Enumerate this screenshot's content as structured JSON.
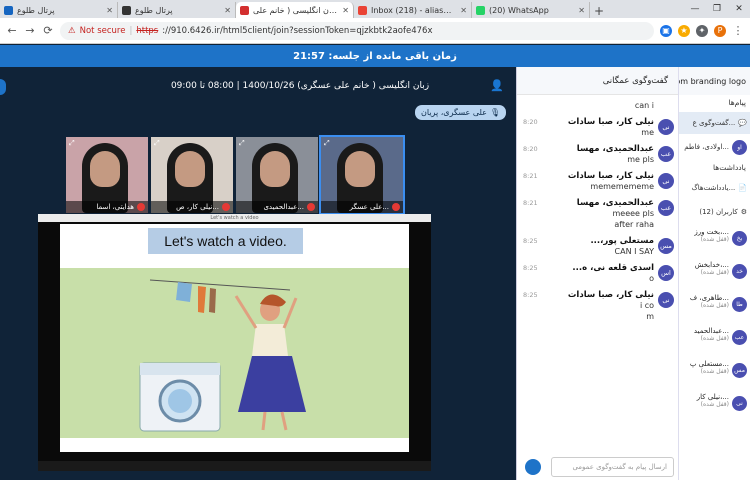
{
  "browser": {
    "tabs": [
      {
        "title": "پرتال طلوع",
        "fav_color": "#1565c0",
        "active": false
      },
      {
        "title": "پرتال طلوع",
        "fav_color": "#333333",
        "active": false
      },
      {
        "title": "طلوع - زبان انگلیسی ( خانم علی",
        "fav_color": "#d32f2f",
        "active": true
      },
      {
        "title": "Inbox (218) - aliasgaripariani@",
        "fav_color": "#ea4335",
        "active": false
      },
      {
        "title": "(20) WhatsApp",
        "fav_color": "#25d366",
        "active": false
      }
    ],
    "new_tab": "+",
    "window_controls": [
      "—",
      "❐",
      "✕"
    ],
    "nav": {
      "back": "←",
      "forward": "→",
      "reload": "⟳"
    },
    "address": {
      "warning_icon": "⚠",
      "not_secure": "Not secure",
      "scheme": "https",
      "rest": "://910.6426.ir/html5client/join?sessionToken=qjzkbtk2aofe476x"
    },
    "profile_initial": "P"
  },
  "header": {
    "timer_label": "زمان باقی مانده از جلسه: 21:57"
  },
  "session": {
    "info": "زبان انگلیسی ( خانم علی عسگری) 1400/10/26 | 08:00 تا 09:00",
    "presenter_badge": "علی عسگری، پریان"
  },
  "video_tiles": [
    {
      "label": "علی عسگر...",
      "active": true,
      "bg": "#5a6a8a"
    },
    {
      "label": "عبدالحمیدی...",
      "active": false,
      "bg": "#8a8f98"
    },
    {
      "label": "نیلی کار، ص...",
      "active": false,
      "bg": "#d8d0c8"
    },
    {
      "label": "هدایتی، اسما",
      "active": false,
      "bg": "#c9a3a8"
    }
  ],
  "slide": {
    "player_title": "Let's watch a video",
    "title": "Let's watch a video."
  },
  "chat": {
    "header": "گفت‌وگوی عمگانی",
    "input_placeholder": "ارسال پیام به گفت‌وگوی عمومی",
    "messages": [
      {
        "initials": "",
        "name": "",
        "time": "",
        "text": "can i"
      },
      {
        "initials": "نی",
        "name": "نیلی کار، صبا سادات",
        "time": "8:20",
        "text": "me"
      },
      {
        "initials": "عب",
        "name": "عبدالحمیدی، مهسا",
        "time": "8:20",
        "text": "me pls"
      },
      {
        "initials": "نی",
        "name": "نیلی کار، صبا سادات",
        "time": "8:21",
        "text": "mememememe"
      },
      {
        "initials": "عب",
        "name": "عبدالحمیدی، مهسا",
        "time": "8:21",
        "text": "meeee pls\nafter raha"
      },
      {
        "initials": "مس",
        "name": "مستعلی پور،...",
        "time": "8:25",
        "text": "CAN I SAY"
      },
      {
        "initials": "اس",
        "name": "اسدی قلعه نی، ه...",
        "time": "8:25",
        "text": "o"
      },
      {
        "initials": "نی",
        "name": "نیلی کار، صبا سادات",
        "time": "8:25",
        "text": "i co\nm"
      }
    ]
  },
  "sidebar": {
    "brand": "custom branding logo",
    "messages_section": "پیام‌ها",
    "public_chat": "گفت‌وگوی ع...",
    "users_list": [
      {
        "initials": "او",
        "name": "اولادی، فاطم..."
      }
    ],
    "notes_section": "یادداشت‌ها",
    "shared_notes": "یادداشت‌هاگ...",
    "users_header": "کاربران (12)",
    "users": [
      {
        "initials": "بخ",
        "name": "بخت ورز،...",
        "status": "(قفل شده)"
      },
      {
        "initials": "خد",
        "name": "خدابخش،...",
        "status": "(قفل شده)"
      },
      {
        "initials": "طا",
        "name": "طاهری، ف...",
        "status": "(قفل شده)"
      },
      {
        "initials": "عب",
        "name": "عبدالحمید...",
        "status": "(قفل شده)"
      },
      {
        "initials": "مس",
        "name": "مستعلی پ...",
        "status": "(قفل شده)"
      },
      {
        "initials": "نی",
        "name": "نیلی کار،...",
        "status": "(قفل شده)"
      }
    ]
  }
}
